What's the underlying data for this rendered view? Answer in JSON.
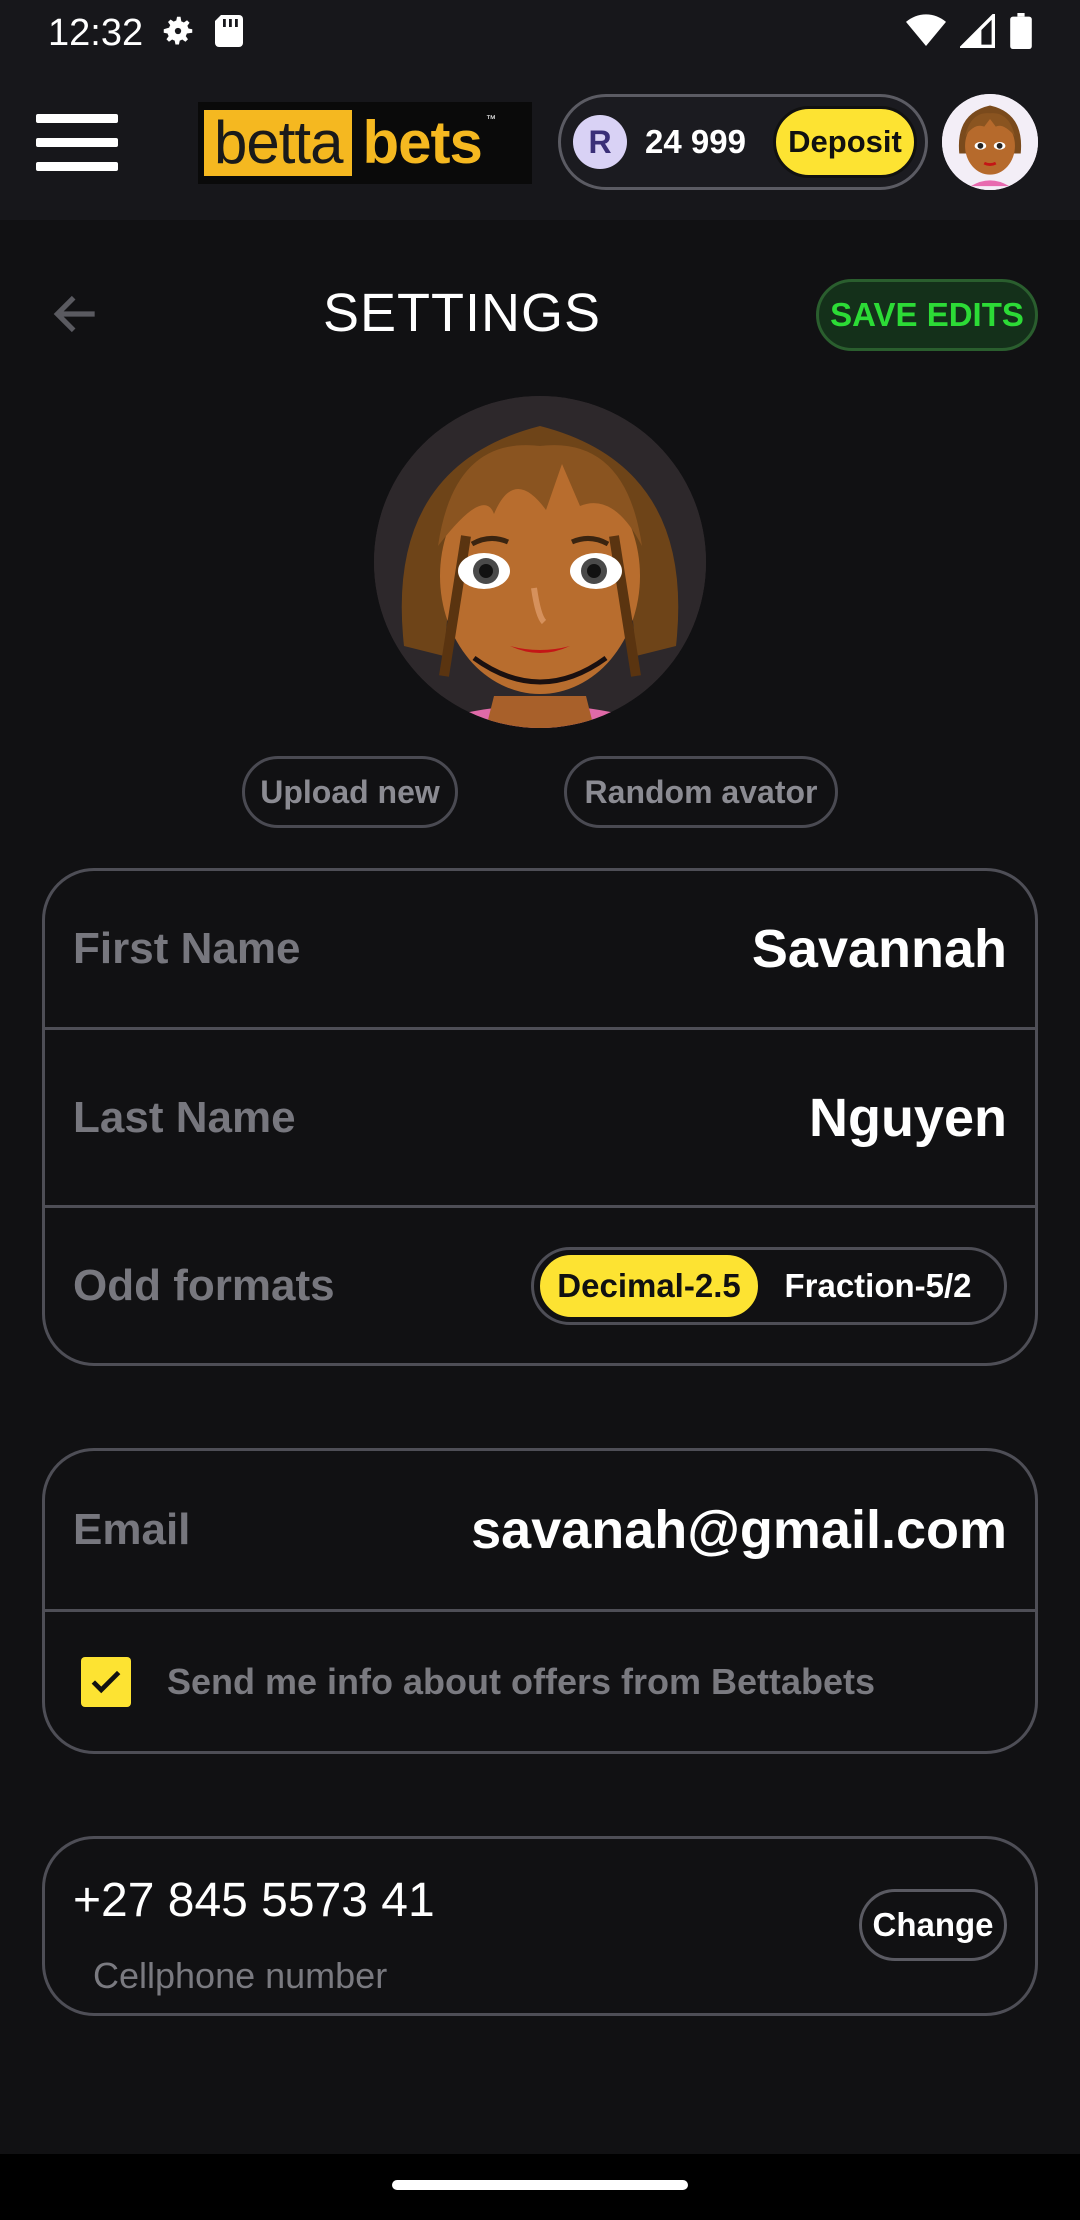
{
  "status_bar": {
    "time": "12:32"
  },
  "header": {
    "logo_part1": "betta",
    "logo_part2": "bets",
    "logo_tm": "™",
    "currency_symbol": "R",
    "balance": "24 999",
    "deposit_label": "Deposit"
  },
  "page": {
    "title": "SETTINGS",
    "save_label": "SAVE EDITS",
    "upload_label": "Upload new",
    "random_label": "Random avator"
  },
  "profile": {
    "first_name_label": "First Name",
    "first_name": "Savannah",
    "last_name_label": "Last Name",
    "last_name": "Nguyen",
    "odd_formats_label": "Odd formats",
    "odd_format_options": [
      "Decimal-2.5",
      "Fraction-5/2"
    ],
    "odd_format_selected": "Decimal-2.5"
  },
  "contact": {
    "email_label": "Email",
    "email": "savanah@gmail.com",
    "offers_label": "Send me info about offers from Bettabets",
    "offers_checked": true
  },
  "phone": {
    "number": "+27 845 5573 41",
    "caption": "Cellphone number",
    "change_label": "Change"
  },
  "colors": {
    "accent_yellow": "#fde332",
    "save_green": "#2cdb36",
    "logo_orange": "#f5b820",
    "background": "#111113"
  }
}
